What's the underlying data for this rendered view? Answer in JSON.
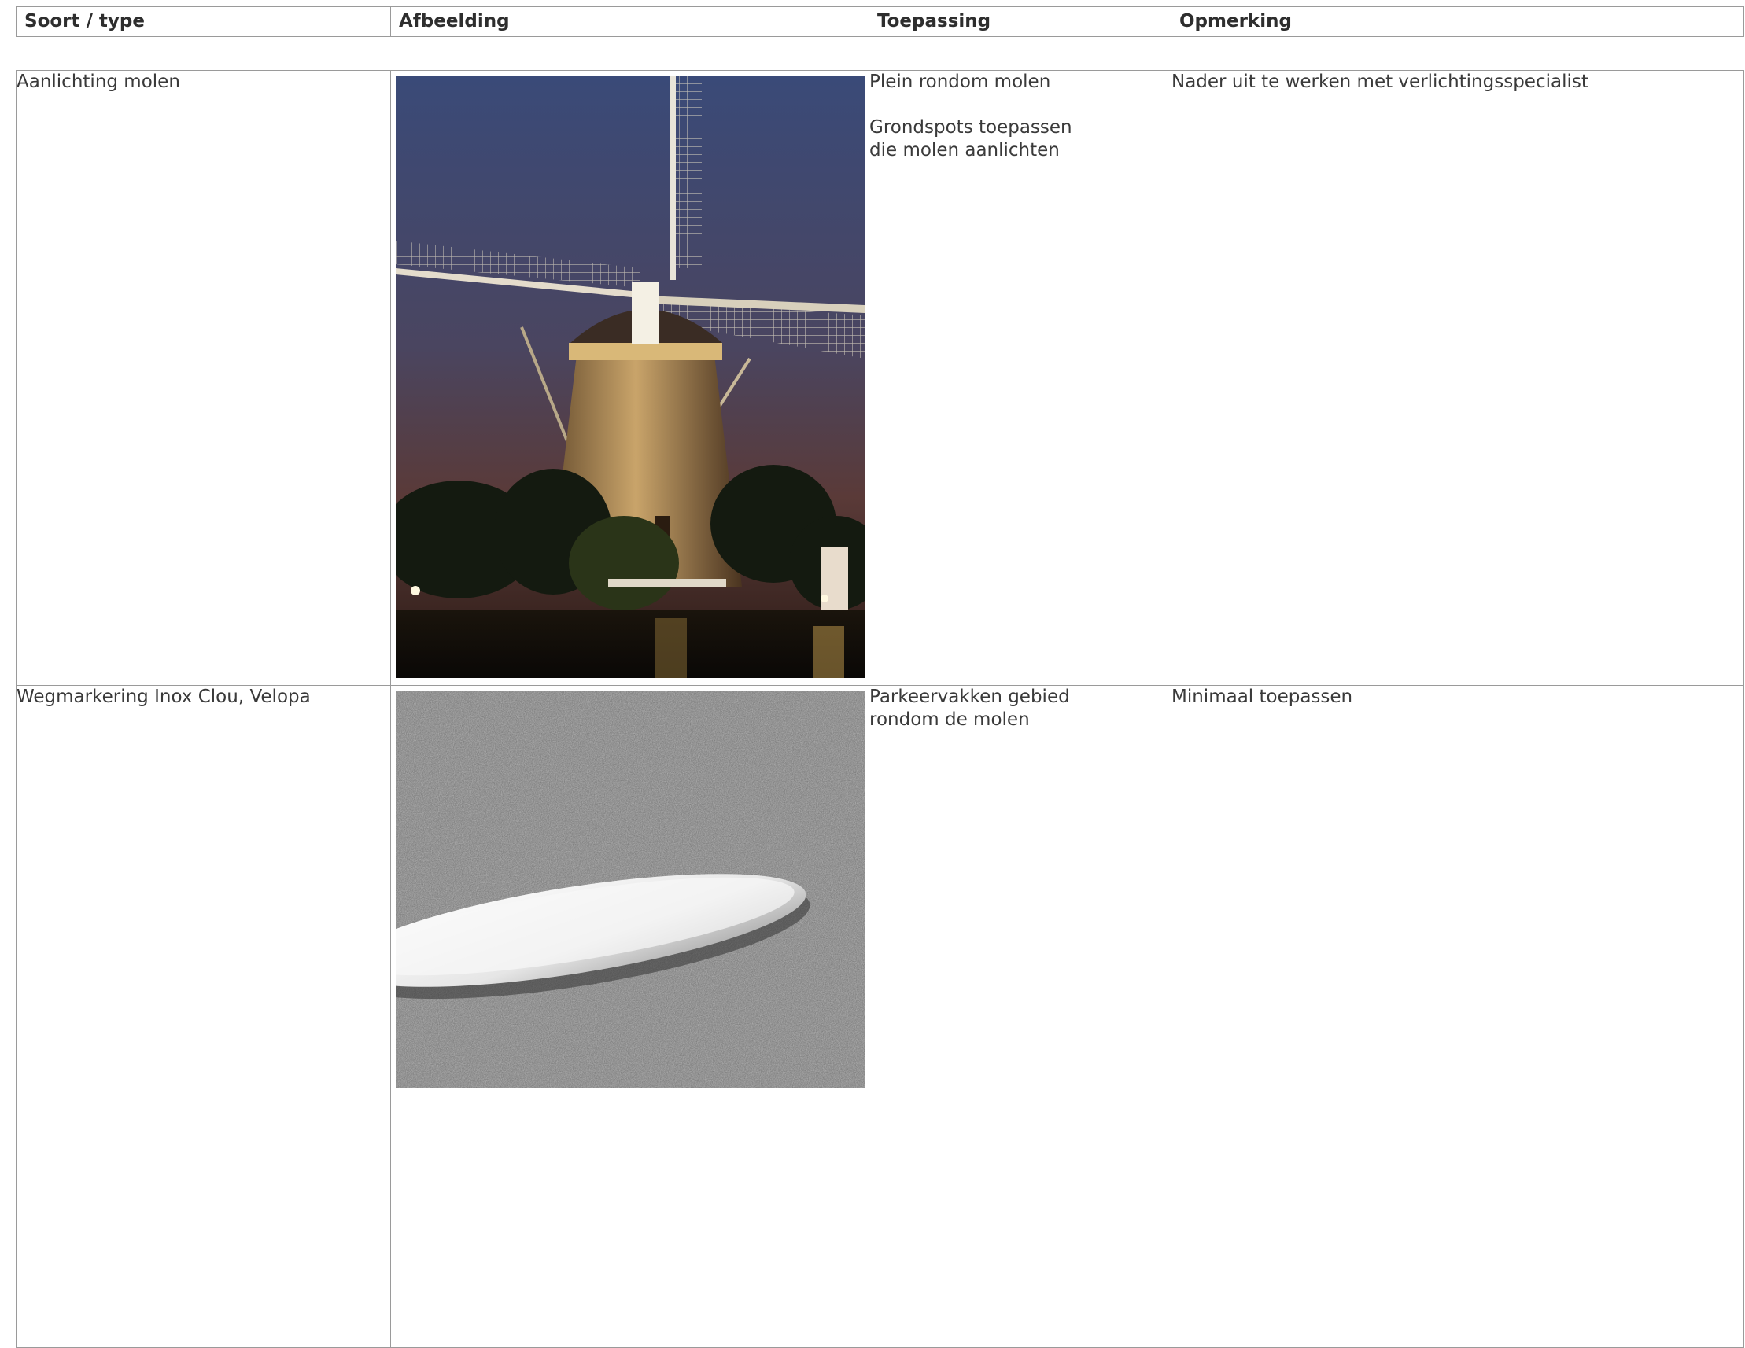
{
  "header": {
    "col1": "Soort / type",
    "col2": "Afbeelding",
    "col3": "Toepassing",
    "col4": "Opmerking"
  },
  "rows": [
    {
      "type": "Aanlichting molen",
      "image": "illuminated-windmill-at-night",
      "toepassing_line1": "Plein rondom molen",
      "toepassing_line2": "Grondspots toepassen",
      "toepassing_line3": "die molen aanlichten",
      "opmerking": "Nader uit te werken met verlichtingsspecialist"
    },
    {
      "type": "Wegmarkering Inox Clou, Velopa",
      "image": "steel-road-stud-on-asphalt",
      "toepassing_line1": "Parkeervakken gebied",
      "toepassing_line2": "rondom de molen",
      "opmerking": "Minimaal toepassen"
    },
    {
      "type": "",
      "toepassing_line1": "",
      "opmerking": ""
    }
  ]
}
